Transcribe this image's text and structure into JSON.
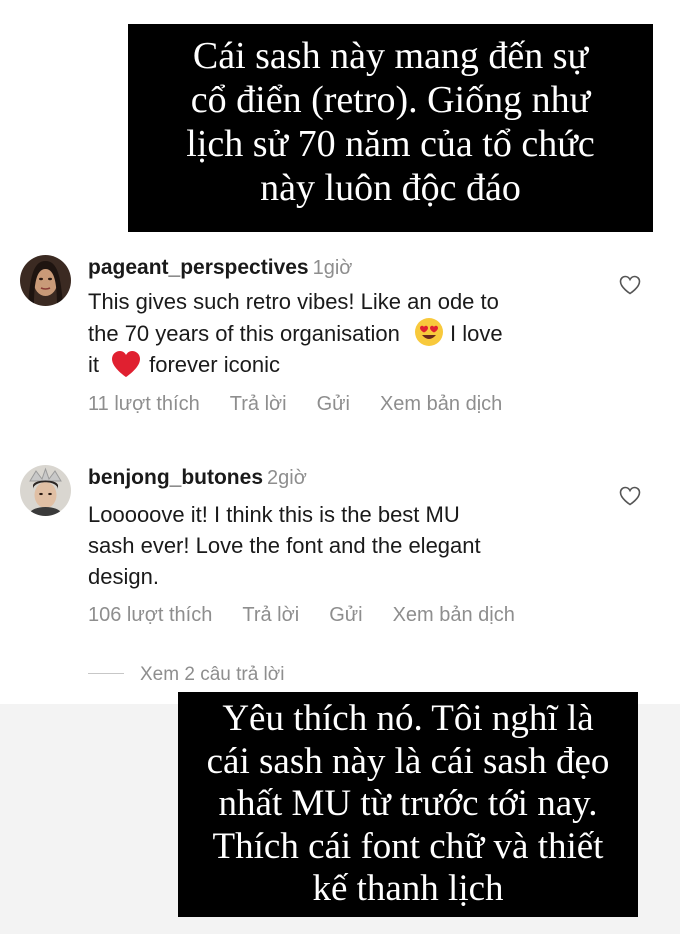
{
  "captions": {
    "top": [
      "Cái sash này mang đến sự",
      "cổ điển (retro). Giống như",
      "lịch sử 70 năm của tổ chức",
      "này luôn độc đáo"
    ],
    "bottom": [
      "Yêu thích nó. Tôi nghĩ là",
      "cái sash này là cái sash đẹo",
      "nhất MU từ trước tới nay.",
      "Thích cái font chữ và thiết",
      "kế thanh lịch"
    ]
  },
  "comments": [
    {
      "username": "pageant_perspectives",
      "time": "1giờ",
      "lines": [
        "This gives such retro vibes! Like an ode to",
        "the 70 years of this organisation",
        "I love",
        "it",
        "forever iconic"
      ],
      "likes": "11 lượt thích",
      "reply": "Trả lời",
      "send": "Gửi",
      "translate": "Xem bản dịch"
    },
    {
      "username": "benjong_butones",
      "time": "2giờ",
      "lines": [
        "Looooove it! I think this is the best MU",
        "sash ever! Love the font and the elegant",
        "design."
      ],
      "likes": "106 lượt thích",
      "reply": "Trả lời",
      "send": "Gửi",
      "translate": "Xem bản dịch"
    }
  ],
  "view_replies": "Xem 2 câu trả lời",
  "icons": {
    "heart": "heart-outline-icon",
    "heart_eyes": "heart-eyes-emoji",
    "red_heart": "red-heart-emoji"
  },
  "colors": {
    "caption_bg": "#000000",
    "muted_text": "#8e8e8e",
    "red_heart": "#e02030",
    "emoji_yellow": "#f8c93c"
  }
}
